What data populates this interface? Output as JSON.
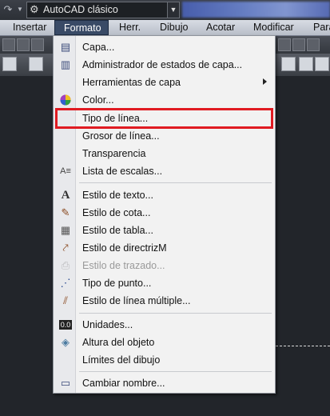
{
  "workspace": {
    "name": "AutoCAD clásico"
  },
  "menubar": {
    "items": [
      {
        "label": "Insertar",
        "active": false
      },
      {
        "label": "Formato",
        "active": true
      },
      {
        "label": "Herr.",
        "active": false
      },
      {
        "label": "Dibujo",
        "active": false
      },
      {
        "label": "Acotar",
        "active": false
      },
      {
        "label": "Modificar",
        "active": false
      },
      {
        "label": "Para",
        "active": false
      }
    ]
  },
  "menu": {
    "items": [
      {
        "label": "Capa...",
        "icon": "layer-icon",
        "disabled": false
      },
      {
        "label": "Administrador de estados de capa...",
        "icon": "layer-states-icon",
        "disabled": false
      },
      {
        "label": "Herramientas de capa",
        "icon": "",
        "disabled": false,
        "submenu": true
      },
      {
        "label": "Color...",
        "icon": "color-wheel-icon",
        "disabled": false
      },
      {
        "label": "Tipo de línea...",
        "icon": "",
        "disabled": false,
        "highlighted": true
      },
      {
        "label": "Grosor de línea...",
        "icon": "",
        "disabled": false
      },
      {
        "label": "Transparencia",
        "icon": "",
        "disabled": false
      },
      {
        "label": "Lista de escalas...",
        "icon": "scale-list-icon",
        "disabled": false
      },
      {
        "label": "Estilo de texto...",
        "icon": "text-style-icon",
        "disabled": false
      },
      {
        "label": "Estilo de cota...",
        "icon": "dimension-style-icon",
        "disabled": false
      },
      {
        "label": "Estilo de tabla...",
        "icon": "table-style-icon",
        "disabled": false
      },
      {
        "label": "Estilo de directrizM",
        "icon": "multileader-style-icon",
        "disabled": false
      },
      {
        "label": "Estilo de trazado...",
        "icon": "plot-style-icon",
        "disabled": true
      },
      {
        "label": "Tipo de punto...",
        "icon": "point-style-icon",
        "disabled": false
      },
      {
        "label": "Estilo de línea múltiple...",
        "icon": "multiline-style-icon",
        "disabled": false
      },
      {
        "label": "Unidades...",
        "icon": "units-icon",
        "disabled": false
      },
      {
        "label": "Altura del objeto",
        "icon": "thickness-icon",
        "disabled": false
      },
      {
        "label": "Límites del dibujo",
        "icon": "",
        "disabled": false
      },
      {
        "label": "Cambiar nombre...",
        "icon": "rename-icon",
        "disabled": false
      }
    ]
  },
  "colors": {
    "highlight_border": "#e01b22",
    "menu_bg": "#f2f2f2",
    "active_menu": "#394a66"
  }
}
